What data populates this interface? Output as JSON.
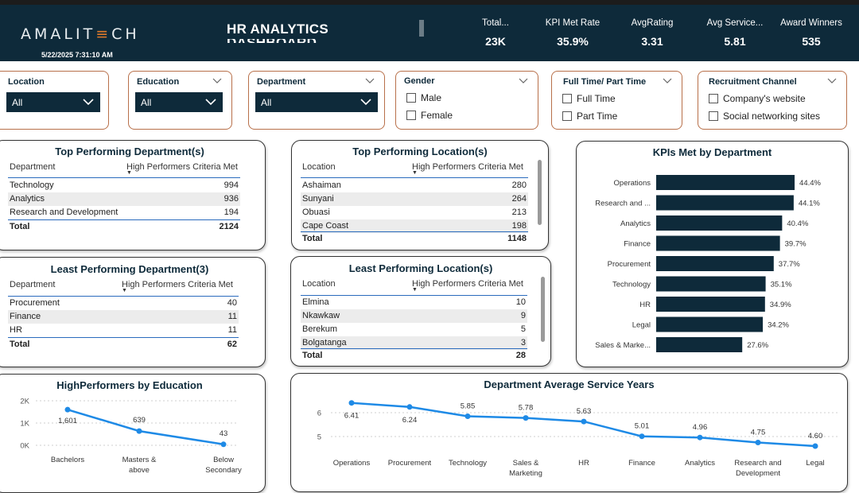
{
  "header": {
    "logo_text": "AMALIT",
    "logo_accent": "≡",
    "logo_tail": "CH",
    "timestamp": "5/22/2025 7:31:10 AM",
    "title": "HR ANALYTICS",
    "title_line2": "DASHBOARD",
    "kpis": [
      {
        "label": "Total...",
        "value": "23K"
      },
      {
        "label": "KPI Met Rate",
        "value": "35.9%"
      },
      {
        "label": "AvgRating",
        "value": "3.31"
      },
      {
        "label": "Avg Service...",
        "value": "5.81"
      },
      {
        "label": "Award Winners",
        "value": "535"
      }
    ]
  },
  "slicers": {
    "location": {
      "title": "Location",
      "value": "All"
    },
    "education": {
      "title": "Education",
      "value": "All"
    },
    "department": {
      "title": "Department",
      "value": "All"
    },
    "gender": {
      "title": "Gender",
      "options": [
        "Male",
        "Female"
      ]
    },
    "employment": {
      "title": "Full Time/ Part Time",
      "options": [
        "Full Time",
        "Part Time"
      ]
    },
    "recruitment": {
      "title": "Recruitment Channel",
      "options": [
        "Company's website",
        "Social networking sites"
      ]
    }
  },
  "top_departments": {
    "title": "Top Performing Department(s)",
    "col1": "Department",
    "col2": "High Performers Criteria Met",
    "rows": [
      {
        "name": "Technology",
        "value": "994"
      },
      {
        "name": "Analytics",
        "value": "936"
      },
      {
        "name": "Research and Development",
        "value": "194"
      }
    ],
    "total_label": "Total",
    "total_value": "2124"
  },
  "top_locations": {
    "title": "Top Performing Location(s)",
    "col1": "Location",
    "col2": "High Performers Criteria Met",
    "rows": [
      {
        "name": "Ashaiman",
        "value": "280"
      },
      {
        "name": "Sunyani",
        "value": "264"
      },
      {
        "name": "Obuasi",
        "value": "213"
      },
      {
        "name": "Cape Coast",
        "value": "198"
      }
    ],
    "total_label": "Total",
    "total_value": "1148"
  },
  "least_departments": {
    "title": "Least Performing Department(3)",
    "col1": "Department",
    "col2": "High Performers Criteria Met",
    "rows": [
      {
        "name": "Procurement",
        "value": "40"
      },
      {
        "name": "Finance",
        "value": "11"
      },
      {
        "name": "HR",
        "value": "11"
      }
    ],
    "total_label": "Total",
    "total_value": "62"
  },
  "least_locations": {
    "title": "Least Performing Location(s)",
    "col1": "Location",
    "col2": "High Performers Criteria Met",
    "rows": [
      {
        "name": "Elmina",
        "value": "10"
      },
      {
        "name": "Nkawkaw",
        "value": "9"
      },
      {
        "name": "Berekum",
        "value": "5"
      },
      {
        "name": "Bolgatanga",
        "value": "3"
      }
    ],
    "total_label": "Total",
    "total_value": "28"
  },
  "colors": {
    "navy": "#0e2a3a",
    "accent_orange": "#e07a2a",
    "line_blue": "#1e8ae6",
    "slicer_border": "#b8704a"
  },
  "chart_data": [
    {
      "type": "bar",
      "orientation": "horizontal",
      "title": "KPIs Met by Department",
      "categories": [
        "Operations",
        "Research and ...",
        "Analytics",
        "Finance",
        "Procurement",
        "Technology",
        "HR",
        "Legal",
        "Sales & Marke..."
      ],
      "values": [
        44.4,
        44.1,
        40.4,
        39.7,
        37.7,
        35.1,
        34.9,
        34.2,
        27.6
      ],
      "labels": [
        "44.4%",
        "44.1%",
        "40.4%",
        "39.7%",
        "37.7%",
        "35.1%",
        "34.9%",
        "34.2%",
        "27.6%"
      ],
      "xlim": [
        0,
        50
      ]
    },
    {
      "type": "line",
      "title": "HighPerformers by Education",
      "categories": [
        "Bachelors",
        "Masters & above",
        "Below Secondary"
      ],
      "values": [
        1601,
        639,
        43
      ],
      "labels": [
        "1,601",
        "639",
        "43"
      ],
      "yticks": [
        "0K",
        "1K",
        "2K"
      ],
      "ylim": [
        0,
        2000
      ],
      "grid": true
    },
    {
      "type": "line",
      "title": "Department Average Service Years",
      "categories": [
        "Operations",
        "Procurement",
        "Technology",
        "Sales & Marketing",
        "HR",
        "Finance",
        "Analytics",
        "Research and Development",
        "Legal"
      ],
      "values": [
        6.41,
        6.24,
        5.85,
        5.78,
        5.63,
        5.01,
        4.96,
        4.75,
        4.6
      ],
      "labels": [
        "6.41",
        "6.24",
        "5.85",
        "5.78",
        "5.63",
        "5.01",
        "4.96",
        "4.75",
        "4.60"
      ],
      "yticks": [
        "5",
        "6"
      ],
      "grid": true
    }
  ]
}
